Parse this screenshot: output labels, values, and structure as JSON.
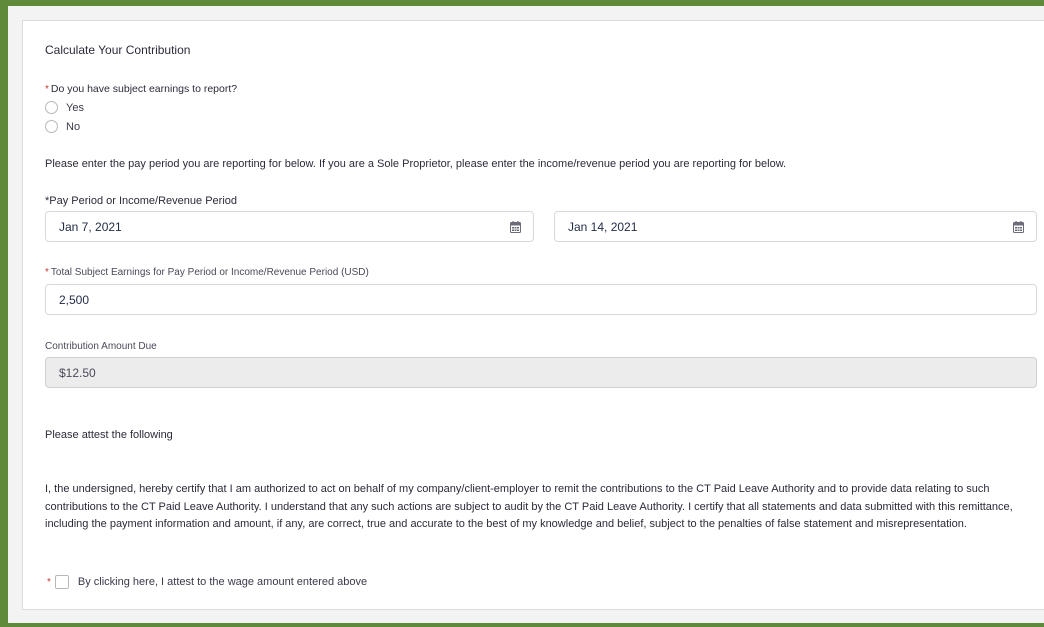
{
  "form": {
    "section_title": "Calculate Your Contribution",
    "required_mark": "*",
    "earnings_question": "Do you have subject earnings to report?",
    "options": [
      {
        "label": "Yes",
        "selected": false
      },
      {
        "label": "No",
        "selected": false
      }
    ],
    "instructions": "Please enter the pay period you are reporting for below. If you are a Sole Proprietor, please enter the income/revenue period you are reporting for below.",
    "pay_period_label": "*Pay Period or Income/Revenue Period",
    "start_date": "Jan 7, 2021",
    "end_date": "Jan 14, 2021",
    "earnings_label": "Total Subject Earnings for Pay Period or Income/Revenue Period (USD)",
    "earnings_value": "2,500",
    "contribution_label": "Contribution Amount Due",
    "contribution_value": "$12.50",
    "attest_title": "Please attest the following",
    "attest_text": "I, the undersigned, hereby certify that I am authorized to act on behalf of my company/client-employer to remit the contributions to the CT Paid Leave Authority and to provide data relating to such contributions to the CT Paid Leave Authority. I understand that any such actions are subject to audit by the CT Paid Leave Authority. I certify that all statements and data submitted with this remittance, including the payment information and amount, if any, are correct, true and accurate to the best of my knowledge and belief, subject to the penalties of false statement and misrepresentation.",
    "attest_checkbox_label": "By clicking here, I attest to the wage amount entered above",
    "attest_checked": false
  },
  "colors": {
    "frame": "#5e8a3a",
    "required": "#c23934",
    "disabled_fill": "#ececec"
  },
  "icons": {
    "date_picker": "calendar-icon"
  }
}
